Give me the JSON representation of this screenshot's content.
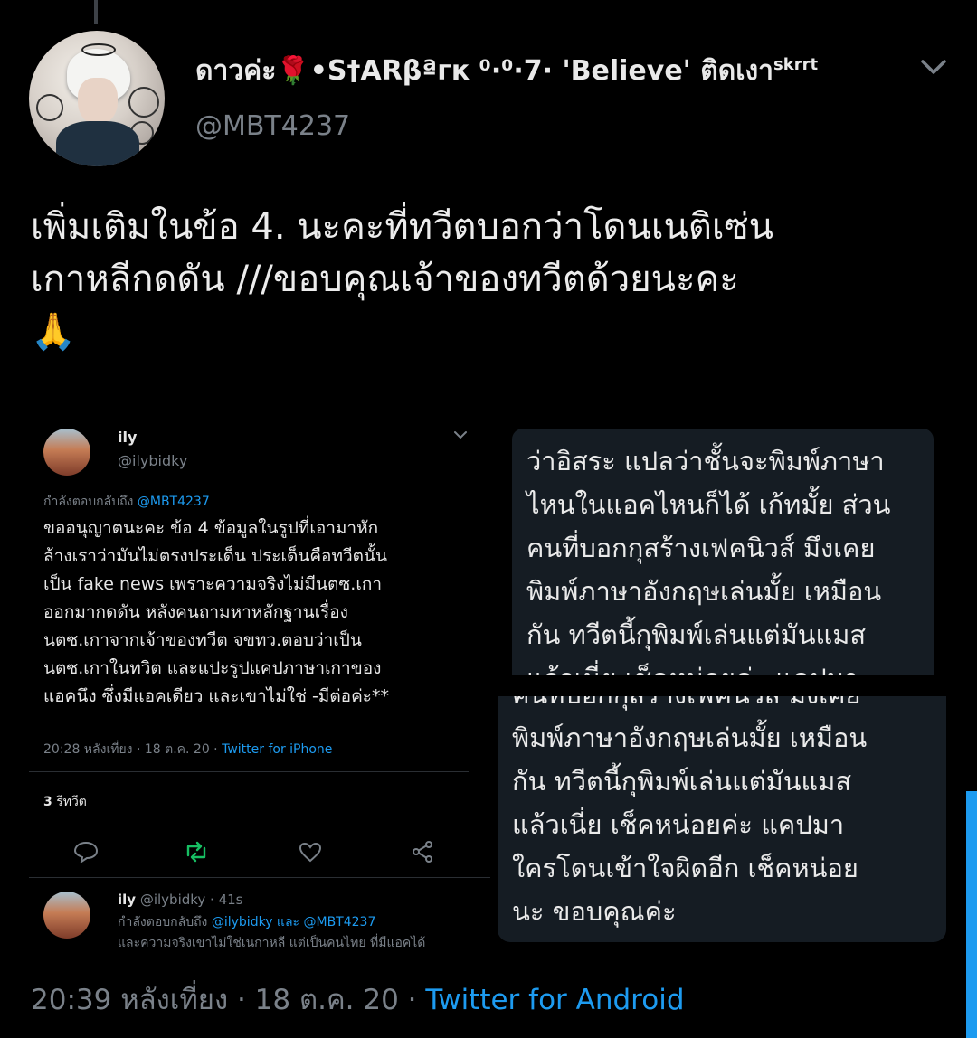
{
  "tweet": {
    "author": {
      "display_name": "ดาวค่ะ🌹•S†ARβªгк ⁰·⁰·7· 'Believe' ติดเงา",
      "display_name_sup": "skrrt",
      "handle": "@MBT4237",
      "avatar_icon": "profile-avatar"
    },
    "menu_icon": "chevron-down-icon",
    "text_lines": [
      "เพิ่มเติมในข้อ 4. นะคะที่ทวีตบอกว่าโดนเนติเซ่น",
      "เกาหลีกดดัน ///ขอบคุณเจ้าของทวีตด้วยนะคะ"
    ],
    "emoji": "🙏",
    "time": "20:39 หลังเที่ยง · 18 ต.ค. 20 · ",
    "source": "Twitter for Android"
  },
  "embedded_1": {
    "name": "ily",
    "handle": "@ilybidky",
    "reply_prefix": "กำลังตอบกลับถึง ",
    "reply_to": "@MBT4237",
    "body_lines": [
      "ขออนุญาตนะคะ ข้อ 4 ข้อมูลในรูปที่เอามาหัก",
      "ล้างเราว่ามันไม่ตรงประเด็น ประเด็นคือทวีตนั้น",
      "เป็น fake news เพราะความจริงไม่มีนตซ.เกา",
      "ออกมากดดัน หลังคนถามหาหลักฐานเรื่อง",
      "นตซ.เกาจากเจ้าของทวีต จขทว.ตอบว่าเป็น",
      "นตซ.เกาในทวิต และแปะรูปแคปภาษาเกาของ",
      "แอคนึง ซึ่งมีแอคเดียว และเขาไม่ใช่ -มีต่อค่ะ**"
    ],
    "meta_time": "20:28 หลังเที่ยง · 18 ต.ค. 20 · ",
    "meta_source": "Twitter for iPhone",
    "retweet_count": "3",
    "retweet_label": " รีทวีต",
    "actions": [
      "reply-icon",
      "retweet-icon",
      "like-icon",
      "share-icon"
    ],
    "accent_retweet": "#17bf63",
    "reply2_name": "ily",
    "reply2_meta": " @ilybidky · 41s",
    "reply2_prefix": "กำลังตอบกลับถึง ",
    "reply2_to": "@ilybidky และ @MBT4237",
    "reply2_cut": "และความจริงเขาไม่ใช่เนกาหลี แต่เป็นคนไทย ที่มีแอคได้"
  },
  "embedded_2": {
    "lines": [
      "ว่าอิสระ แปลว่าชั้นจะพิมพ์ภาษา",
      "ไหนในแอคไหนก็ได้ เก้ทมั้ย ส่วน",
      "คนที่บอกกุสร้างเฟคนิวส์ มึงเคย",
      "พิมพ์ภาษาอังกฤษเล่นมั้ย เหมือน",
      "กัน ทวีตนี้กุพิมพ์เล่นแต่มันแมส",
      "แล้วเนี่ย เช็คหน่อยค่ะ แคปมา"
    ]
  },
  "embedded_3": {
    "lines": [
      "คนที่บอกกุสร้างเฟคนิวส์ มึงเคย",
      "พิมพ์ภาษาอังกฤษเล่นมั้ย เหมือน",
      "กัน ทวีตนี้กุพิมพ์เล่นแต่มันแมส",
      "แล้วเนี่ย เช็คหน่อยค่ะ แคปมา",
      "ใครโดนเข้าใจผิดอีก เช็คหน่อย",
      "นะ ขอบคุณค่ะ"
    ]
  },
  "colors": {
    "background": "#000000",
    "link": "#1d9bf0",
    "muted": "#7a8189",
    "card": "#151c23"
  }
}
